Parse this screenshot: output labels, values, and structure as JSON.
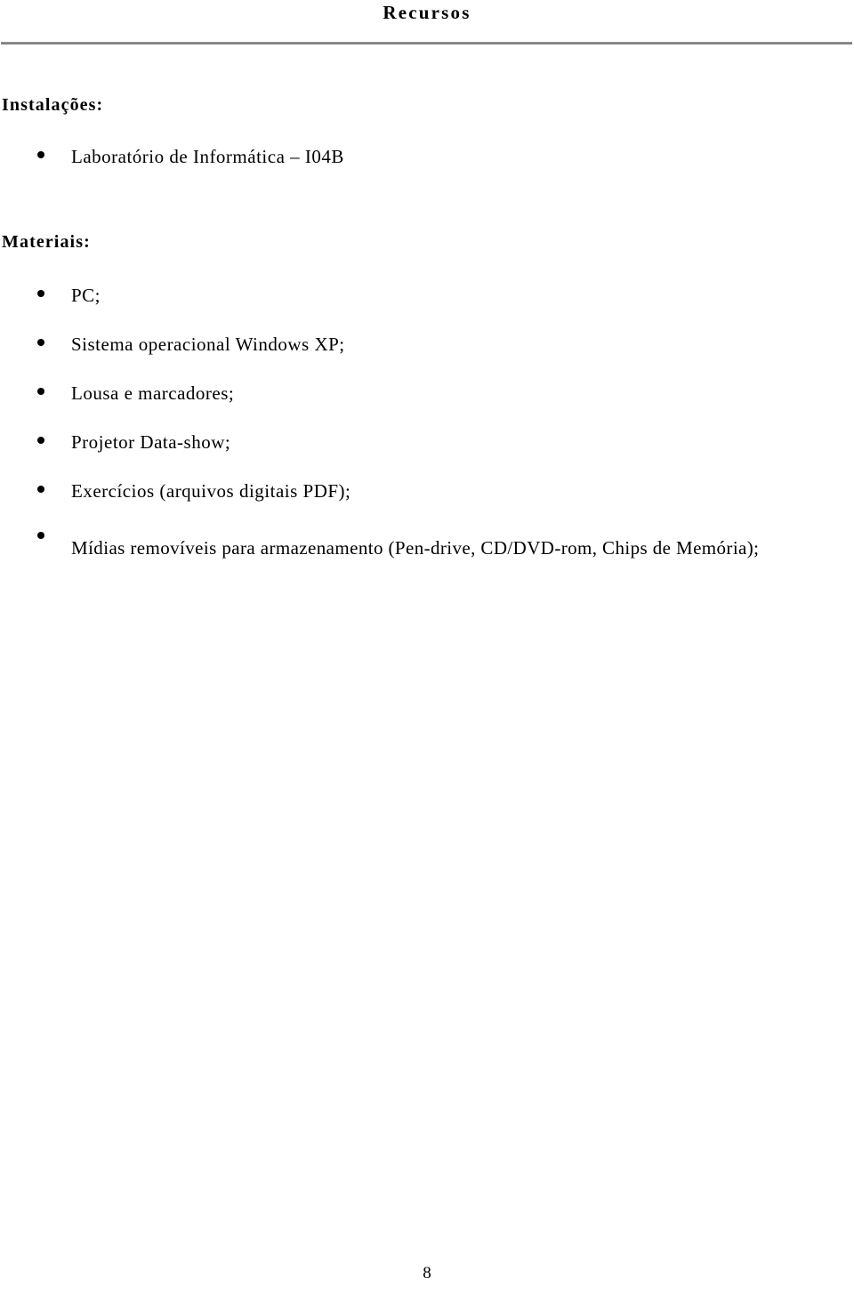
{
  "document": {
    "title": "Recursos",
    "page_number": "8",
    "rule_color": "#808080",
    "text_color": "#000000",
    "background": "#ffffff"
  },
  "sections": [
    {
      "heading": "Instalações:",
      "items": [
        "Laboratório de Informática – I04B"
      ]
    },
    {
      "heading": "Materiais:",
      "items": [
        "PC;",
        "Sistema operacional Windows XP;",
        "Lousa e marcadores;",
        "Projetor Data-show;",
        "Exercícios (arquivos digitais PDF);",
        "Mídias removíveis para armazenamento (Pen-drive, CD/DVD-rom, Chips de Memória);"
      ]
    }
  ]
}
